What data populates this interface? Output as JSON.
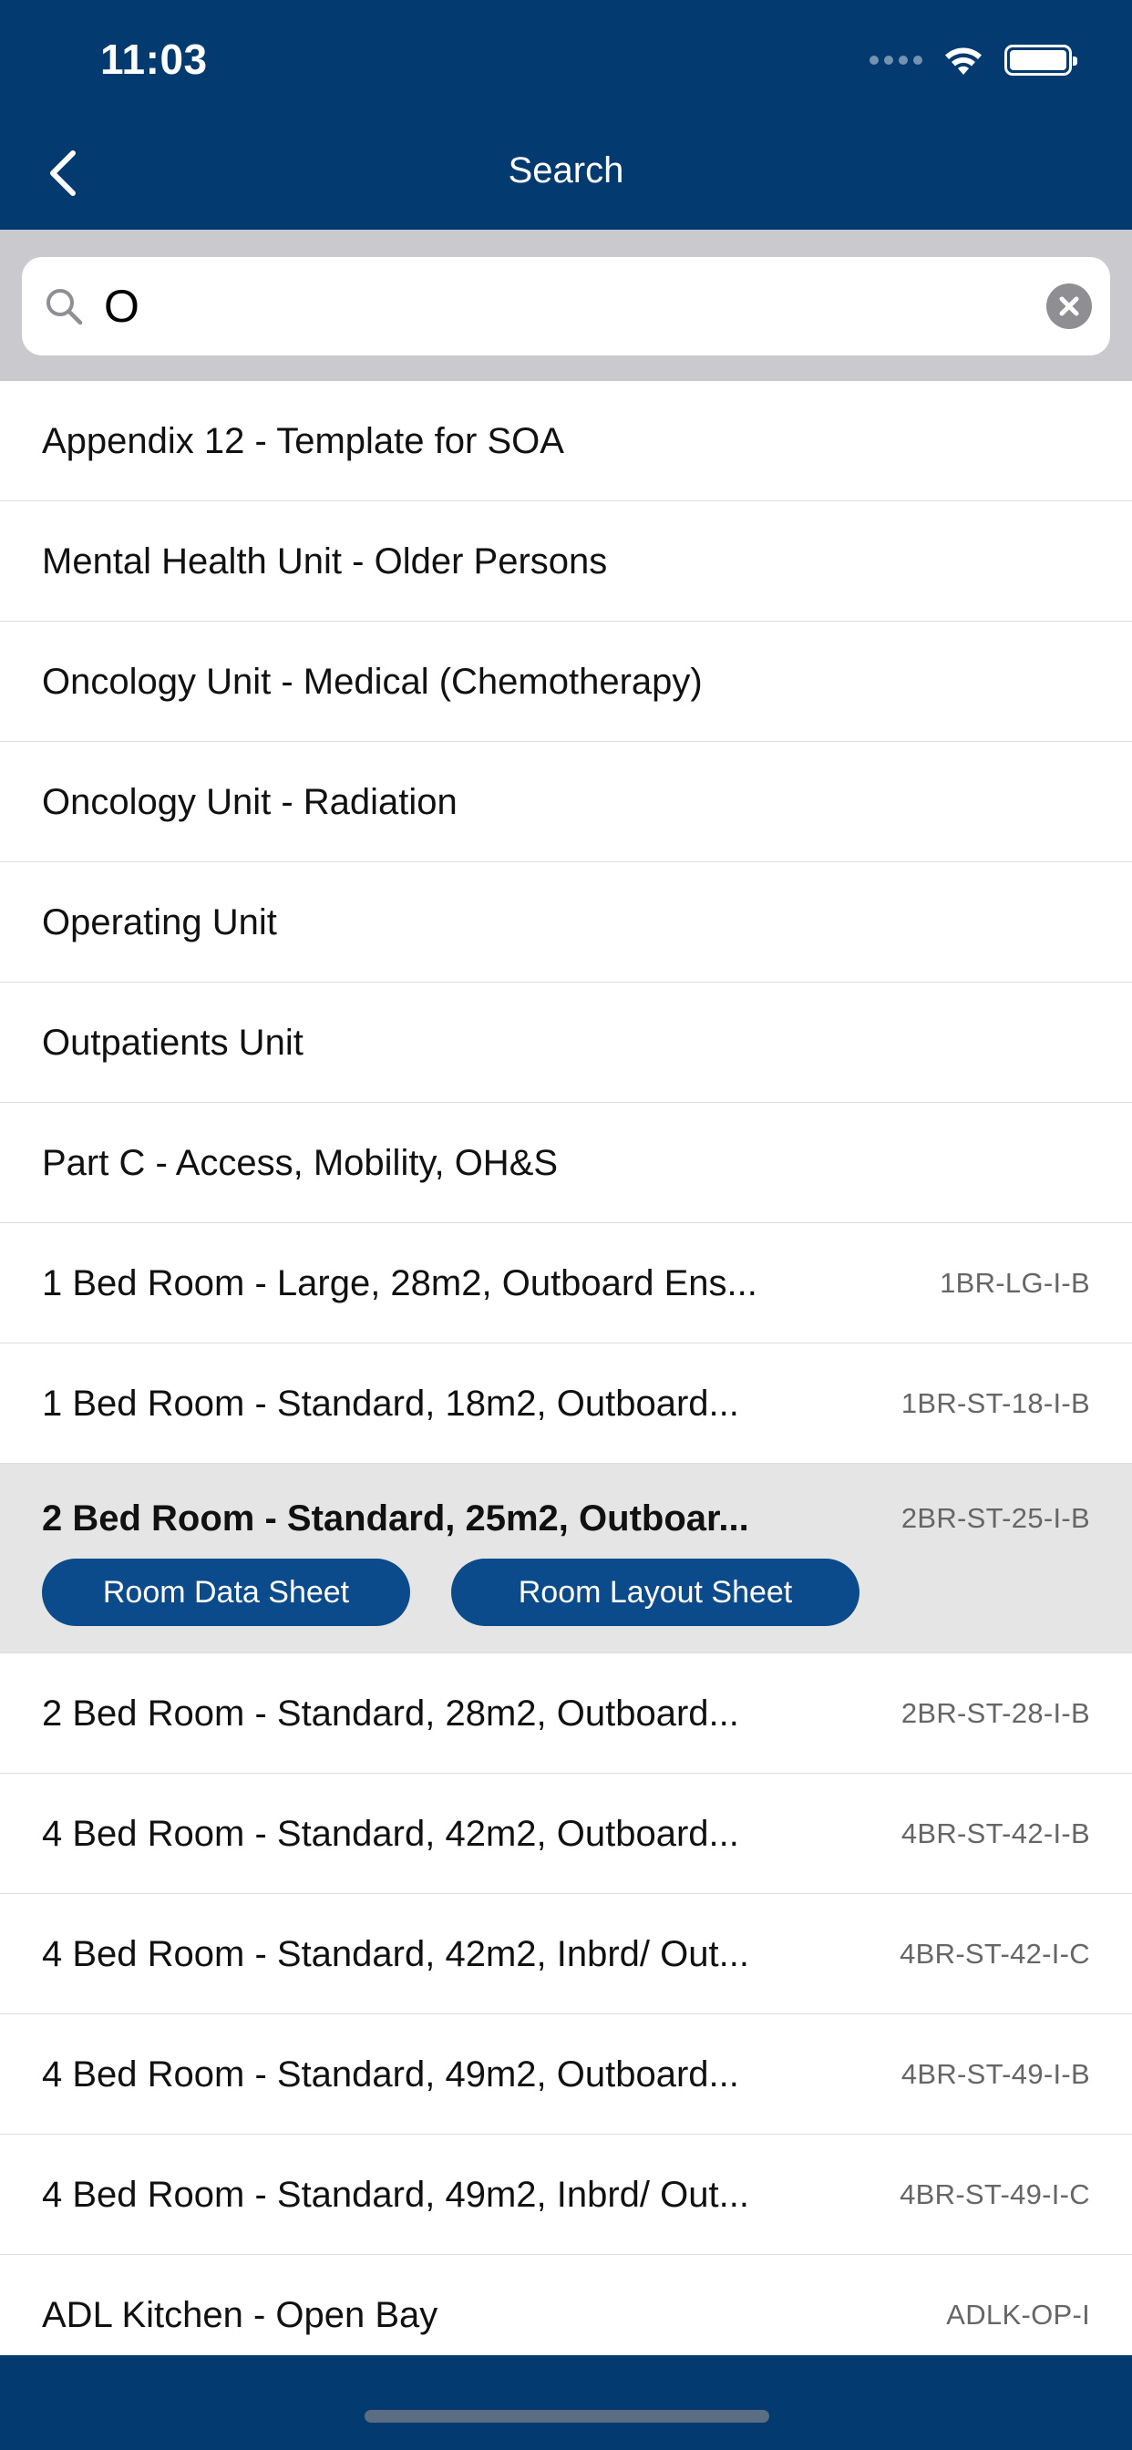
{
  "status_bar": {
    "time": "11:03",
    "icons": [
      "cellular-signal-icon",
      "wifi-icon",
      "battery-icon"
    ]
  },
  "nav": {
    "title": "Search",
    "back_icon": "chevron-left-icon"
  },
  "search": {
    "value": "O",
    "icon": "search-icon",
    "clear_icon": "clear-icon"
  },
  "results": [
    {
      "label": "Appendix 12 - Template for SOA",
      "code": ""
    },
    {
      "label": "Mental Health Unit - Older Persons",
      "code": ""
    },
    {
      "label": "Oncology Unit - Medical (Chemotherapy)",
      "code": ""
    },
    {
      "label": "Oncology Unit - Radiation",
      "code": ""
    },
    {
      "label": "Operating Unit",
      "code": ""
    },
    {
      "label": "Outpatients Unit",
      "code": ""
    },
    {
      "label": "Part C - Access, Mobility, OH&S",
      "code": ""
    },
    {
      "label": "1 Bed Room - Large, 28m2,  Outboard Ens...",
      "code": "1BR-LG-I-B"
    },
    {
      "label": "1 Bed Room - Standard, 18m2, Outboard...",
      "code": "1BR-ST-18-I-B"
    },
    {
      "label": "2 Bed Room - Standard, 25m2, Outboar...",
      "code": "2BR-ST-25-I-B",
      "selected": true
    },
    {
      "label": "2 Bed Room - Standard, 28m2, Outboard...",
      "code": "2BR-ST-28-I-B"
    },
    {
      "label": "4 Bed Room - Standard, 42m2, Outboard...",
      "code": "4BR-ST-42-I-B"
    },
    {
      "label": "4 Bed Room - Standard, 42m2, Inbrd/ Out...",
      "code": "4BR-ST-42-I-C"
    },
    {
      "label": "4 Bed Room - Standard, 49m2, Outboard...",
      "code": "4BR-ST-49-I-B"
    },
    {
      "label": "4 Bed Room - Standard, 49m2, Inbrd/ Out...",
      "code": "4BR-ST-49-I-C"
    },
    {
      "label": "ADL Kitchen - Open Bay",
      "code": "ADLK-OP-I"
    }
  ],
  "selected_actions": {
    "room_data_sheet": "Room Data Sheet",
    "room_layout_sheet": "Room Layout Sheet"
  },
  "colors": {
    "header": "#033b70",
    "action_button": "#0b4a8b",
    "selected_row": "#e5e5e5",
    "search_background": "#c9c9ce"
  }
}
